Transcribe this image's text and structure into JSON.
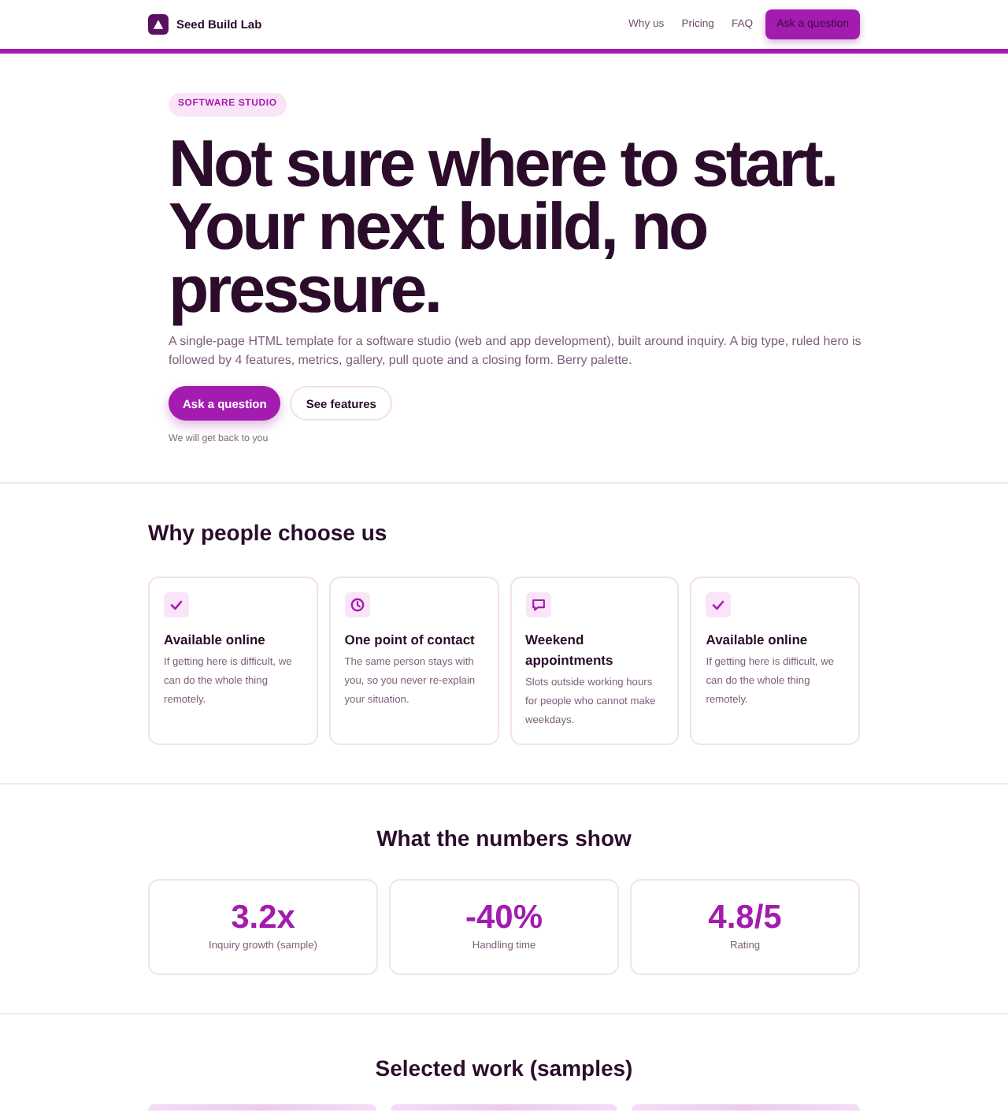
{
  "header": {
    "brand": "Seed Build Lab",
    "nav": [
      {
        "label": "Why us"
      },
      {
        "label": "Pricing"
      },
      {
        "label": "FAQ"
      }
    ],
    "cta": "Ask a question"
  },
  "hero": {
    "badge": "SOFTWARE STUDIO",
    "title": "Not sure where to start. Your next build, no pressure.",
    "lead": "A single-page HTML template for a software studio (web and app development), built around inquiry. A big type, ruled hero is followed by 4 features, metrics, gallery, pull quote and a closing form. Berry palette.",
    "buttons": [
      {
        "label": "Ask a question",
        "kind": "primary"
      },
      {
        "label": "See features",
        "kind": "secondary"
      }
    ],
    "note": "We will get back to you"
  },
  "features": {
    "title": "Why people choose us",
    "items": [
      {
        "kind": "check",
        "title": "Available online",
        "text": "If getting here is difficult, we can do the whole thing remotely."
      },
      {
        "kind": "clock",
        "title": "One point of contact",
        "text": "The same person stays with you, so you never re-explain your situation."
      },
      {
        "kind": "chat",
        "title": "Weekend appointments",
        "text": "Slots outside working hours for people who cannot make weekdays."
      },
      {
        "kind": "check",
        "title": "Available online",
        "text": "If getting here is difficult, we can do the whole thing remotely."
      }
    ]
  },
  "metrics": {
    "title": "What the numbers show",
    "items": [
      {
        "value": "3.2x",
        "label": "Inquiry growth (sample)"
      },
      {
        "value": "-40%",
        "label": "Handling time"
      },
      {
        "value": "4.8/5",
        "label": "Rating"
      }
    ]
  },
  "gallery": {
    "title": "Selected work (samples)",
    "tiles": [
      {
        "kind": "photo"
      },
      {
        "kind": "photo"
      },
      {
        "kind": "photo"
      }
    ]
  }
}
